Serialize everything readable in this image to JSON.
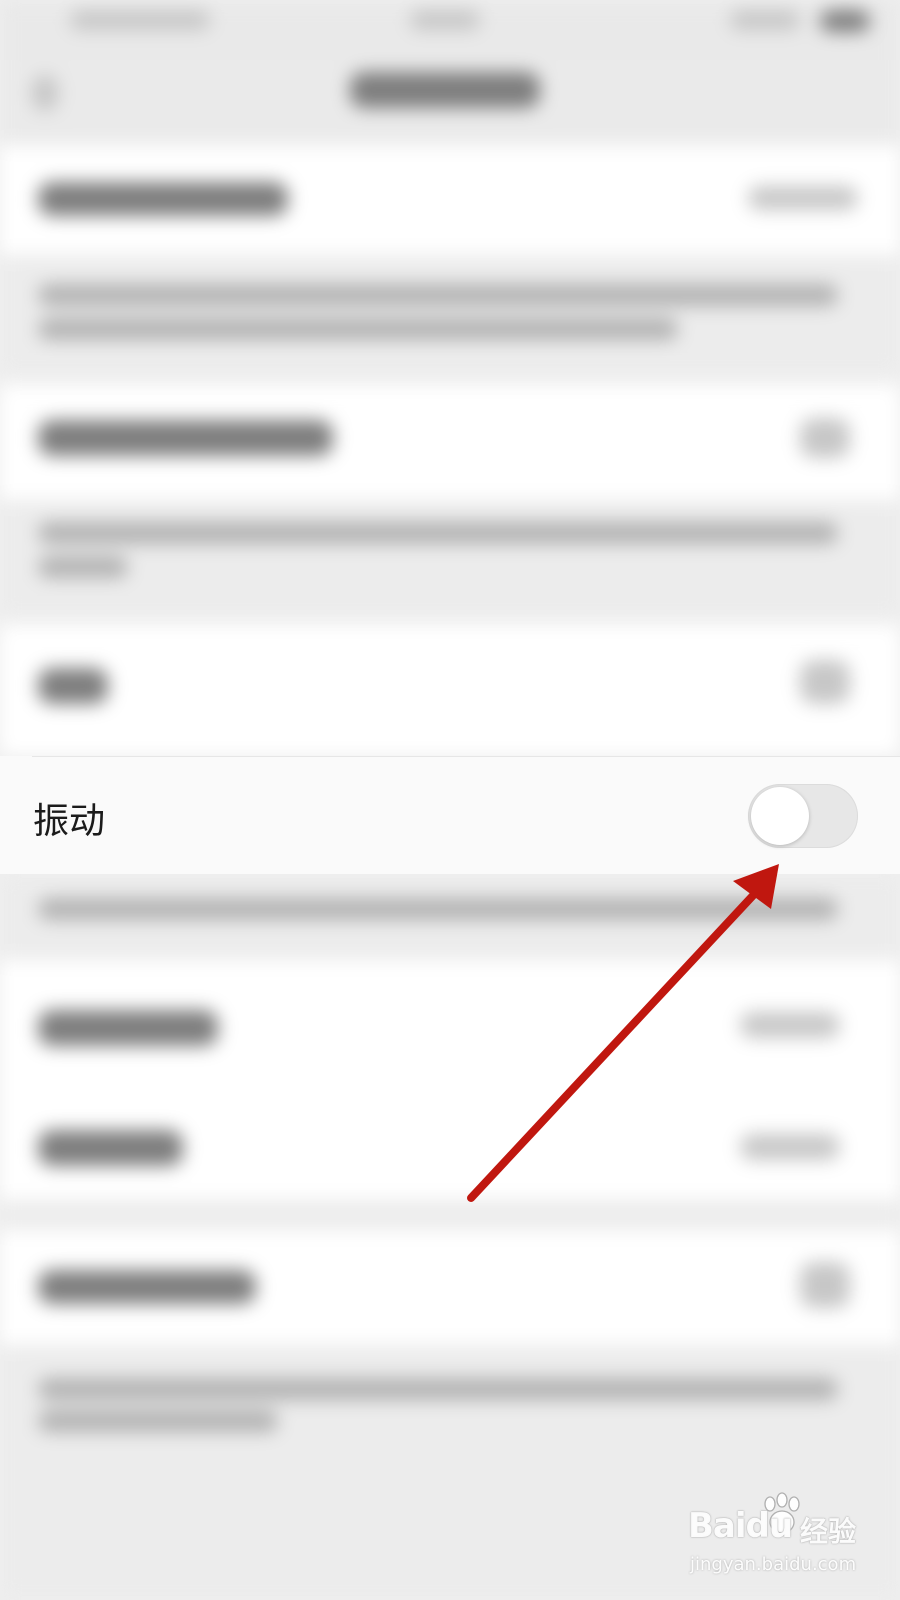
{
  "setting_row": {
    "label": "振动",
    "toggle_state": "off"
  },
  "watermark": {
    "brand": "Baidu",
    "product": "经验",
    "url": "jingyan.baidu.com"
  },
  "colors": {
    "arrow": "#c0170f",
    "toggle_track": "#e7e7e7",
    "toggle_knob": "#ffffff",
    "background": "#efefef"
  }
}
